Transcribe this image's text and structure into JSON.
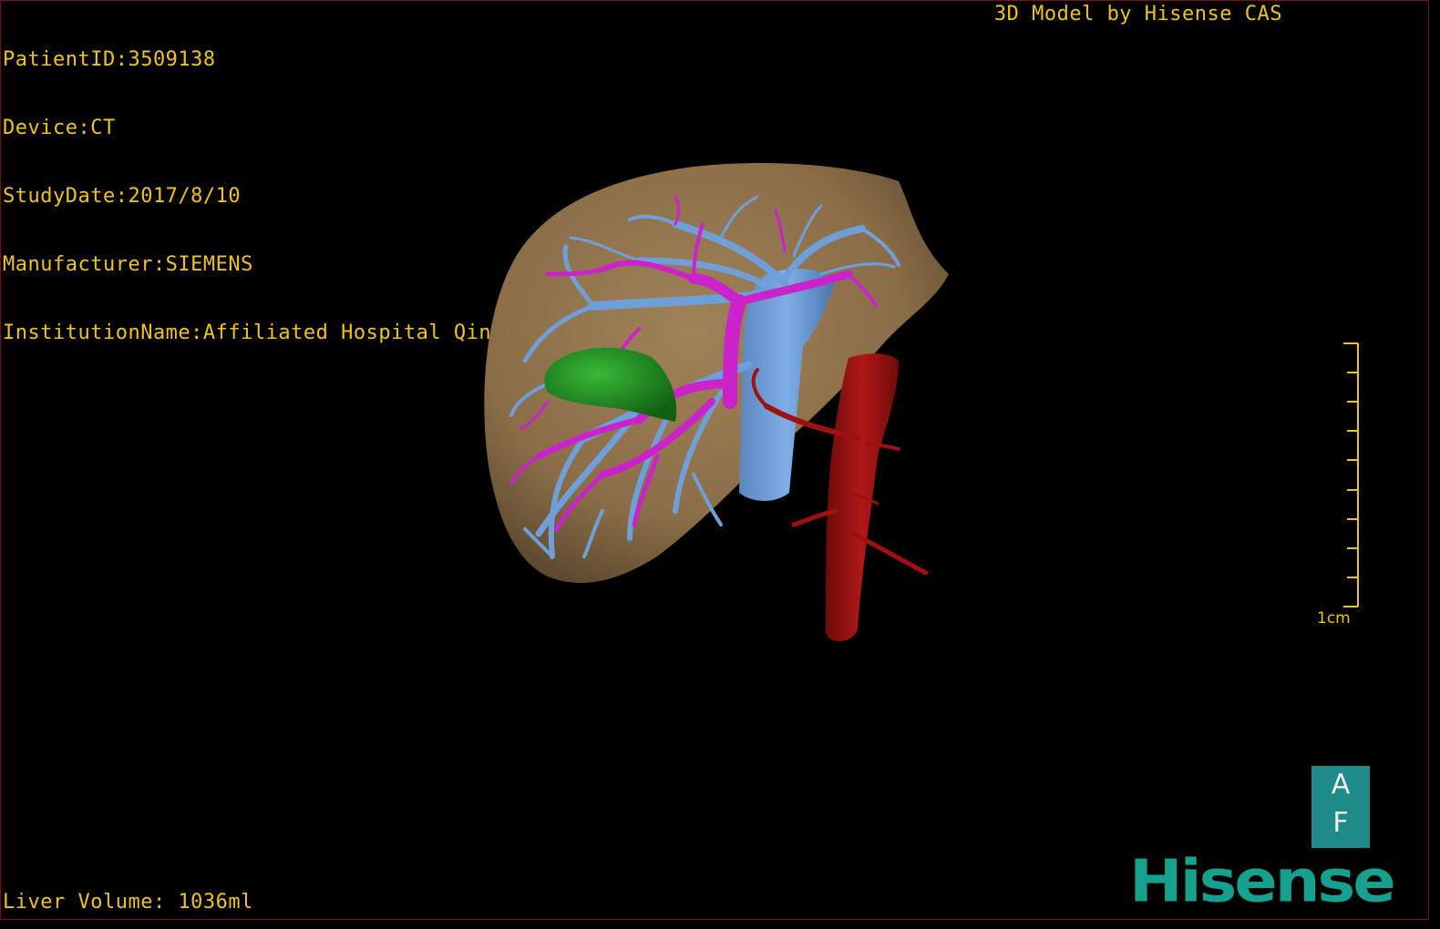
{
  "overlay": {
    "patient_id": "PatientID:3509138",
    "device": "Device:CT",
    "study_date": "StudyDate:2017/8/10",
    "manufacturer": "Manufacturer:SIEMENS",
    "institution": "InstitutionName:Affiliated Hospital Qingdao University-C",
    "model_credit": "3D Model by Hisense CAS",
    "liver_volume": "Liver Volume: 1036ml"
  },
  "scale_bar": {
    "label": "1cm"
  },
  "orientation_cube": {
    "top_letter": "A",
    "bottom_letter": "F"
  },
  "brand": {
    "logo_text": "Hisense"
  },
  "colors": {
    "overlay_text": "#f0c21c",
    "liver": "#8c6f48",
    "hepatic_vein": "#6f9fd8",
    "portal_vein": "#cc22cc",
    "tumor": "#1e8c1e",
    "artery": "#a01010",
    "orientation_cube": "#1f8a8a",
    "brand": "#16a08e"
  }
}
